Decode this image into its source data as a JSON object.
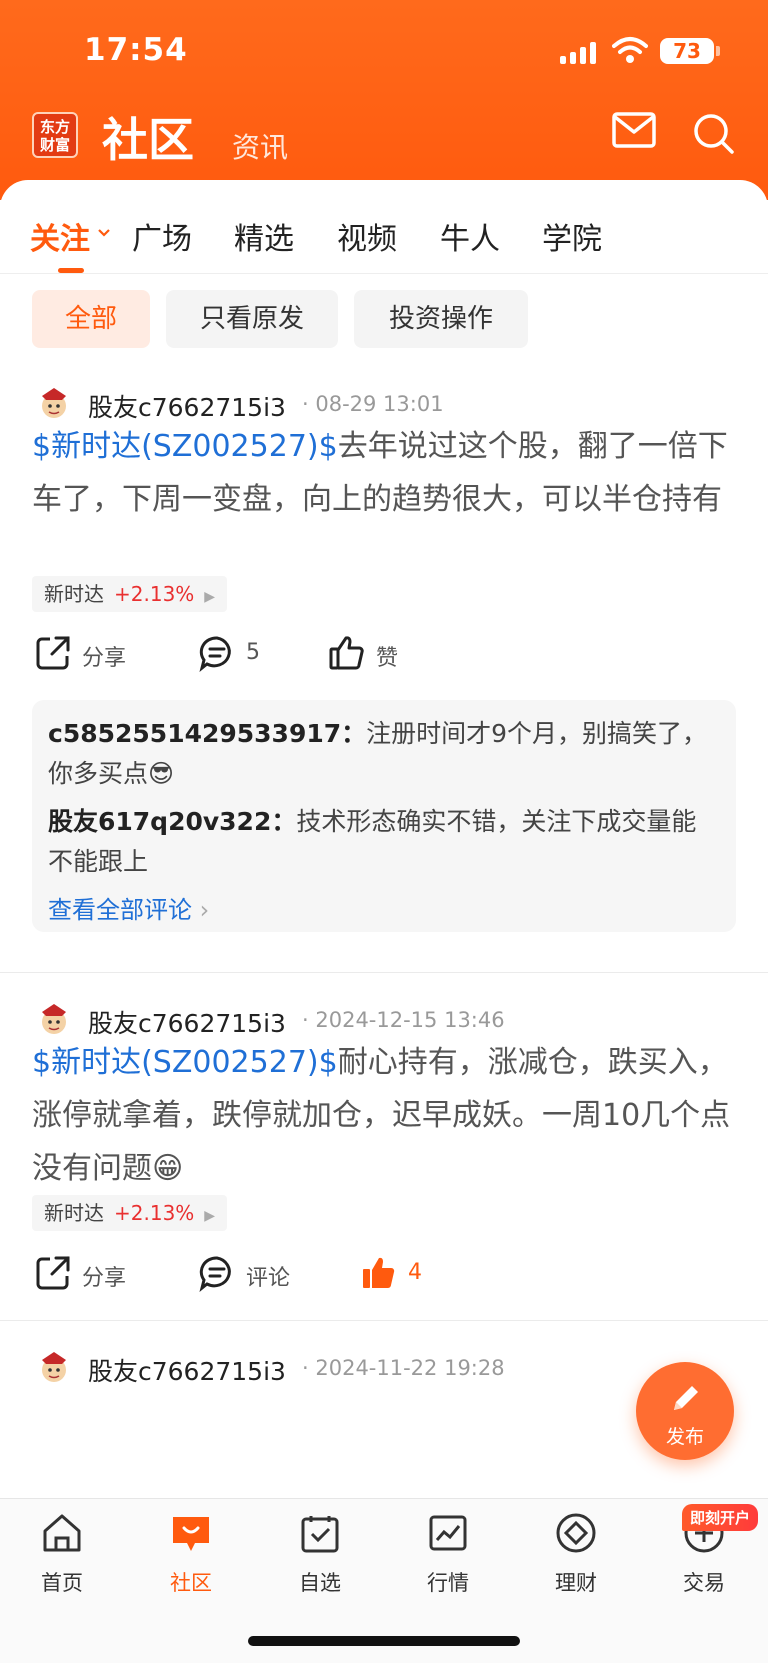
{
  "status": {
    "time": "17:54",
    "battery": "73"
  },
  "header": {
    "logo": "东方财富",
    "title": "社区",
    "subtitle": "资讯"
  },
  "tabs": [
    "关注",
    "广场",
    "精选",
    "视频",
    "牛人",
    "学院"
  ],
  "filters": [
    "全部",
    "只看原发",
    "投资操作"
  ],
  "posts": [
    {
      "author": "股友c7662715i3",
      "time": "08-29 13:01",
      "stock_link": "$新时达(SZ002527)$",
      "text": "去年说过这个股，翻了一倍下车了，下周一变盘，向上的趋势很大，可以半仓持有",
      "tag_name": "新时达",
      "tag_change": "+2.13%",
      "share": "分享",
      "comments": "5",
      "likes": "赞",
      "comment_list": [
        {
          "name": "c5852551429533917：",
          "text": "注册时间才9个月，别搞笑了，你多买点😎"
        },
        {
          "name": "股友617q20v322：",
          "text": "技术形态确实不错，关注下成交量能不能跟上"
        }
      ],
      "view_all": "查看全部评论"
    },
    {
      "author": "股友c7662715i3",
      "time": "2024-12-15 13:46",
      "stock_link": "$新时达(SZ002527)$",
      "text": "耐心持有，涨减仓，跌买入，涨停就拿着，跌停就加仓，迟早成妖。一周10几个点没有问题😁",
      "tag_name": "新时达",
      "tag_change": "+2.13%",
      "share": "分享",
      "comments": "评论",
      "likes": "4"
    },
    {
      "author": "股友c7662715i3",
      "time": "2024-11-22 19:28"
    }
  ],
  "fab": "发布",
  "bottom_nav": [
    "首页",
    "社区",
    "自选",
    "行情",
    "理财",
    "交易"
  ],
  "badge": "即刻开户",
  "colors": {
    "brand": "#ff5a0e",
    "link": "#1f6fd6",
    "up": "#e93030"
  }
}
